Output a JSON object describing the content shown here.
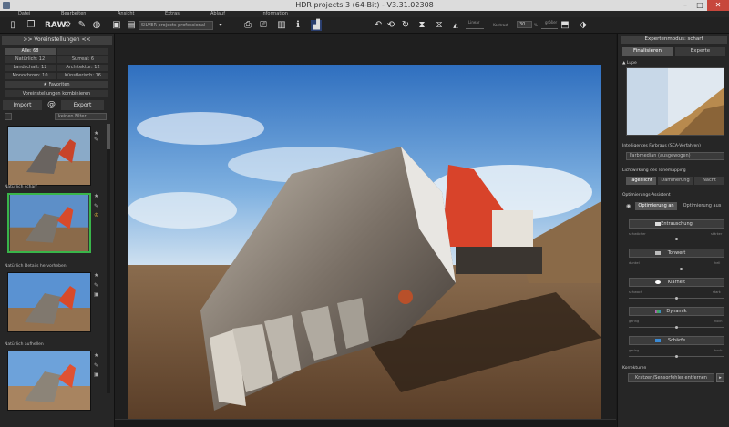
{
  "window": {
    "title": "HDR projects 3 (64-Bit) - V3.31.02308"
  },
  "menu": [
    "Datei",
    "Bearbeiten",
    "Ansicht",
    "Extras",
    "Ablauf",
    "Information"
  ],
  "toolbar": {
    "raw_label": "RAW",
    "preset_select": "SILVER projects professional",
    "linear_label": "Linear",
    "contrast_label": "Kontrast",
    "contrast_value": "30",
    "contrast_unit": "%",
    "size_label": "größer"
  },
  "left": {
    "header": ">> Voreinstellungen <<",
    "categories": [
      {
        "label": "Alle: 68",
        "active": true
      },
      {
        "label": "",
        "active": false
      },
      {
        "label": "Natürlich: 12",
        "active": false
      },
      {
        "label": "Surreal: 6",
        "active": false
      },
      {
        "label": "Landschaft: 12",
        "active": false
      },
      {
        "label": "Architektur: 12",
        "active": false
      },
      {
        "label": "Monochrom: 10",
        "active": false
      },
      {
        "label": "Künstlerisch: 16",
        "active": false
      }
    ],
    "favorites_label": "Favoriten",
    "combine_label": "Voreinstellungen kombinieren",
    "import_label": "Import",
    "export_label": "Export",
    "filter_label": "keinen Filter",
    "presets": [
      {
        "name": ""
      },
      {
        "name": "Natürlich scharf"
      },
      {
        "name": "Natürlich Details hervorheben"
      },
      {
        "name": "Natürlich aufhellen"
      }
    ]
  },
  "right": {
    "header": "Expertenmodus: scharf",
    "tabs": [
      {
        "label": "Finalisieren",
        "active": true
      },
      {
        "label": "Experte",
        "active": false
      }
    ],
    "loupe_label": "Lupe",
    "color_section": "Intelligentes Farbraus (SCA-Verfahren)",
    "color_select": "Farbmedian (ausgewogen)",
    "tonemapping_section": "Lichtwirkung des Tonemapping",
    "light_modes": [
      {
        "label": "Tageslicht",
        "active": true
      },
      {
        "label": "Dämmerung",
        "active": false
      },
      {
        "label": "Nacht",
        "active": false
      }
    ],
    "optimize_section": "Optimierungs-Assistent",
    "optimize_on": "Optimierung an",
    "optimize_off": "Optimierung aus",
    "sliders": [
      {
        "label": "Entrauschung",
        "left": "schwächer",
        "right": "stärker",
        "swatch": "#dddddd",
        "value": 0.5
      },
      {
        "label": "Tonwert",
        "left": "dunkel",
        "right": "hell",
        "swatch": "#bbbbbb",
        "value": 0.55
      },
      {
        "label": "Klarheit",
        "left": "schwach",
        "right": "stark",
        "swatch": "#ffffff",
        "value": 0.5
      },
      {
        "label": "Dynamik",
        "left": "gering",
        "right": "hoch",
        "swatch": "#d44ad4",
        "value": 0.5
      },
      {
        "label": "Schärfe",
        "left": "gering",
        "right": "hoch",
        "swatch": "#3a8ad4",
        "value": 0.5
      }
    ],
    "correct_section": "Korrekturen",
    "scratch_label": "Kratzer-/Sensorfehler entfernen"
  }
}
